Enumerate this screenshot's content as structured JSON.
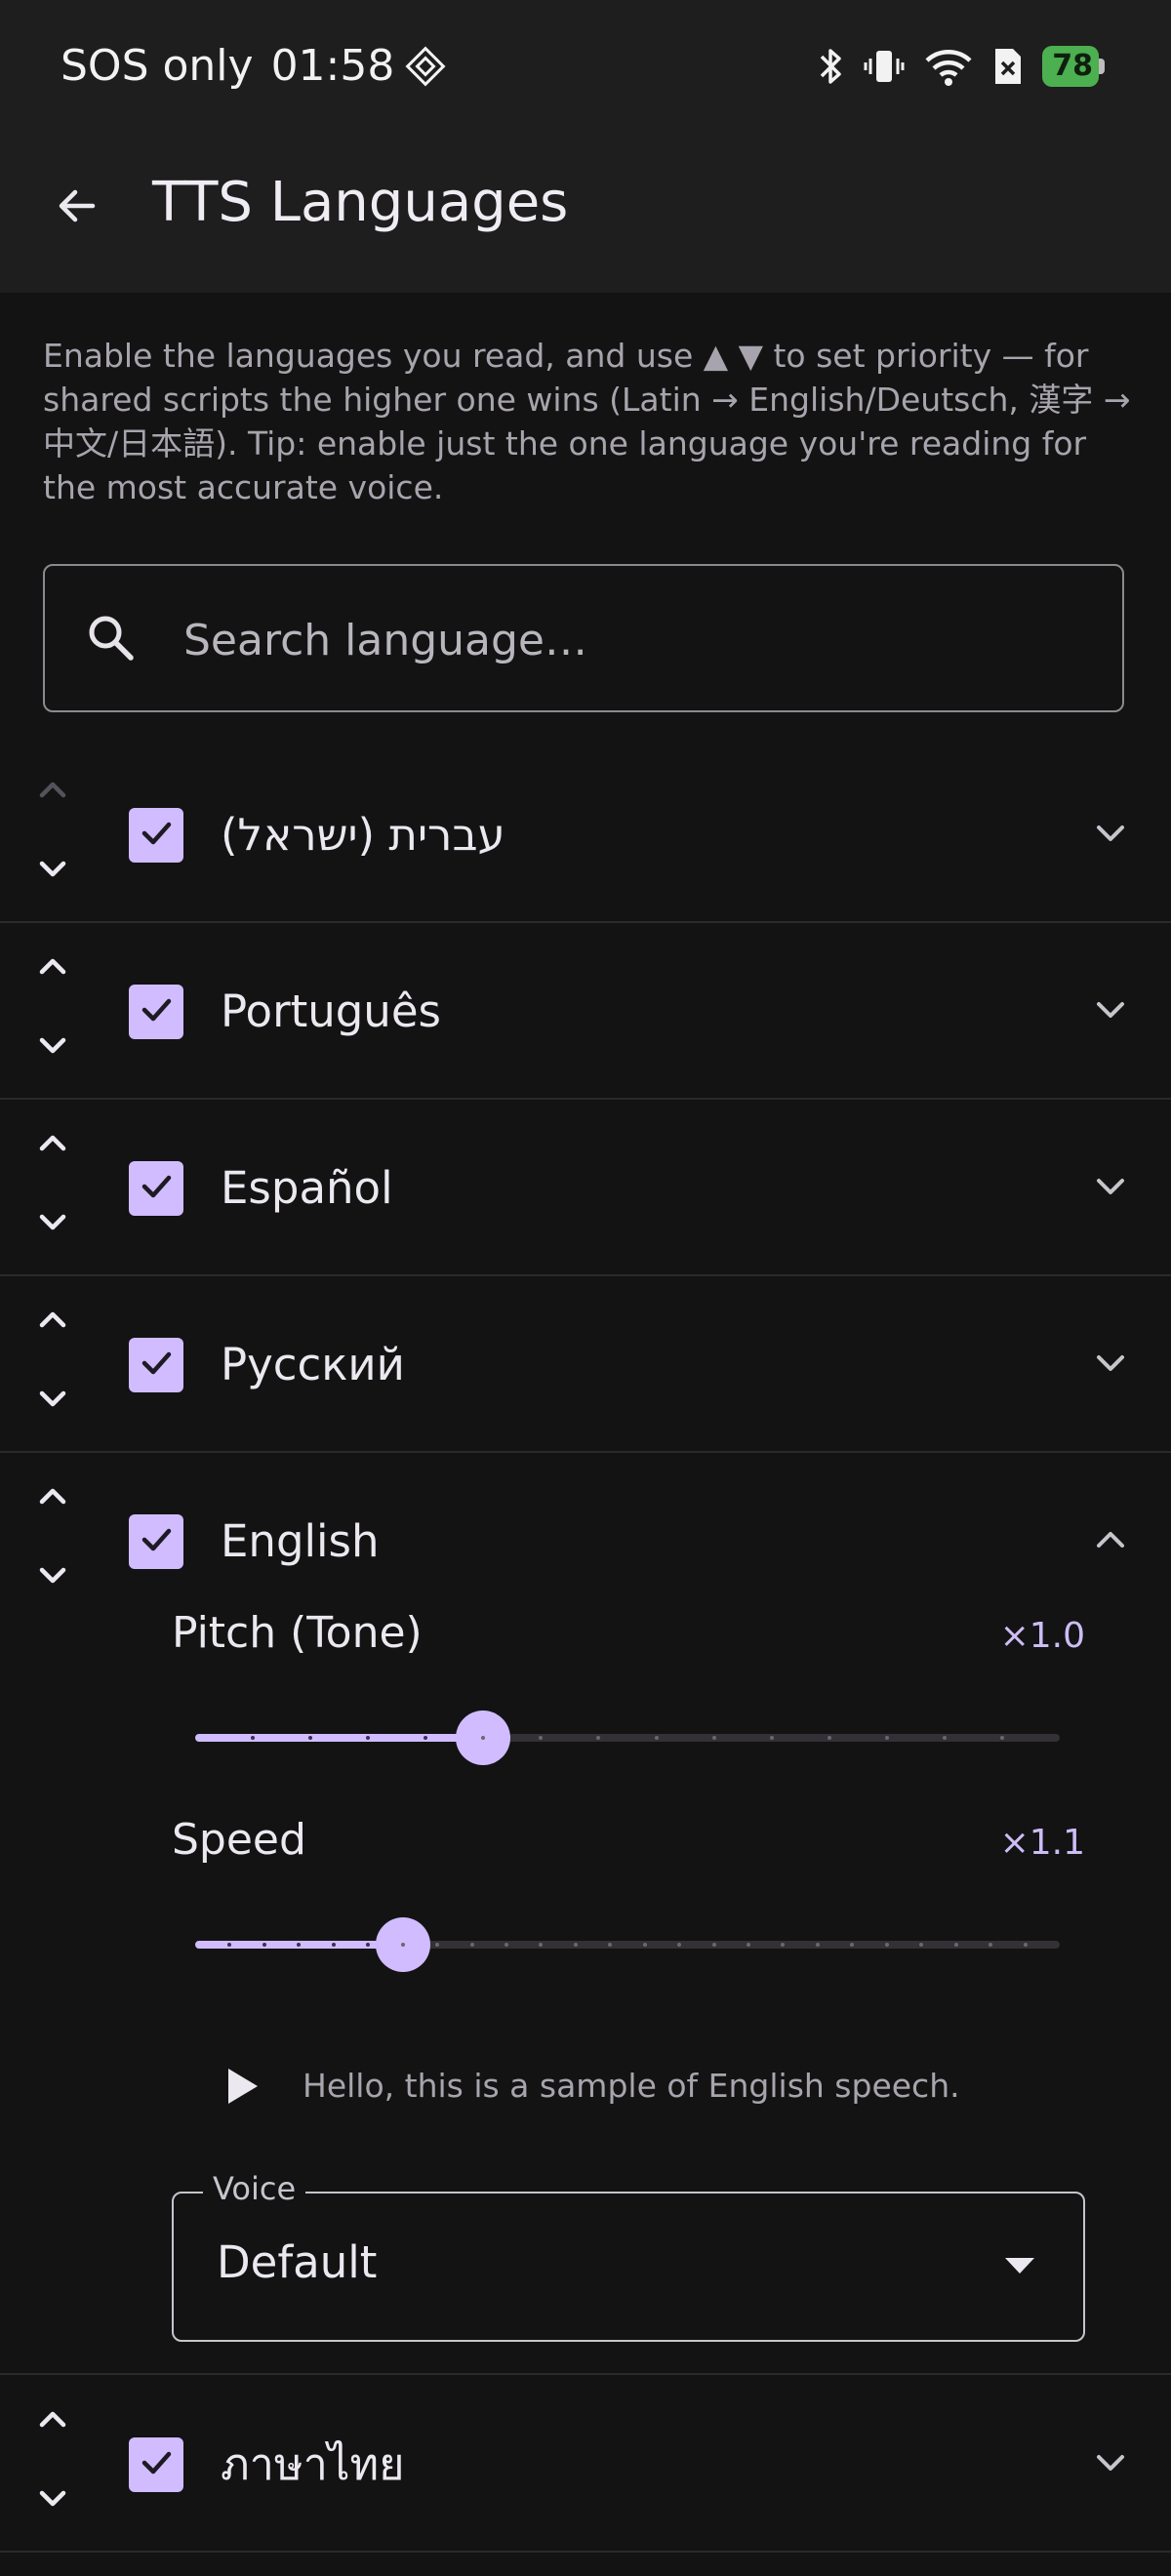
{
  "status_bar": {
    "network": "SOS only",
    "time": "01:58",
    "battery": "78"
  },
  "app_bar": {
    "title": "TTS Languages"
  },
  "intro_text": "Enable the languages you read, and use ▲ ▼ to set priority — for shared scripts the higher one wins (Latin → English/Deutsch, 漢字 → 中文/日本語). Tip: enable just the one language you're reading for the most accurate voice.",
  "search": {
    "placeholder": "Search language…",
    "value": ""
  },
  "languages": [
    {
      "name": "עברית (ישראל)",
      "checked": true,
      "expanded": false
    },
    {
      "name": "Português",
      "checked": true,
      "expanded": false
    },
    {
      "name": "Español",
      "checked": true,
      "expanded": false
    },
    {
      "name": "Русский",
      "checked": true,
      "expanded": false
    },
    {
      "name": "English",
      "checked": true,
      "expanded": true
    },
    {
      "name": "ภาษาไทย",
      "checked": true,
      "expanded": false
    }
  ],
  "english_settings": {
    "pitch": {
      "label": "Pitch (Tone)",
      "value_text": "×1.0",
      "position": 0.333
    },
    "speed": {
      "label": "Speed",
      "value_text": "×1.1",
      "position": 0.24
    },
    "sample_text": "Hello, this is a sample of English speech.",
    "voice": {
      "label": "Voice",
      "value": "Default"
    }
  },
  "colors": {
    "accent": "#d0bcff",
    "background": "#131313",
    "surface": "#1e1e1e",
    "battery": "#4caf50"
  }
}
